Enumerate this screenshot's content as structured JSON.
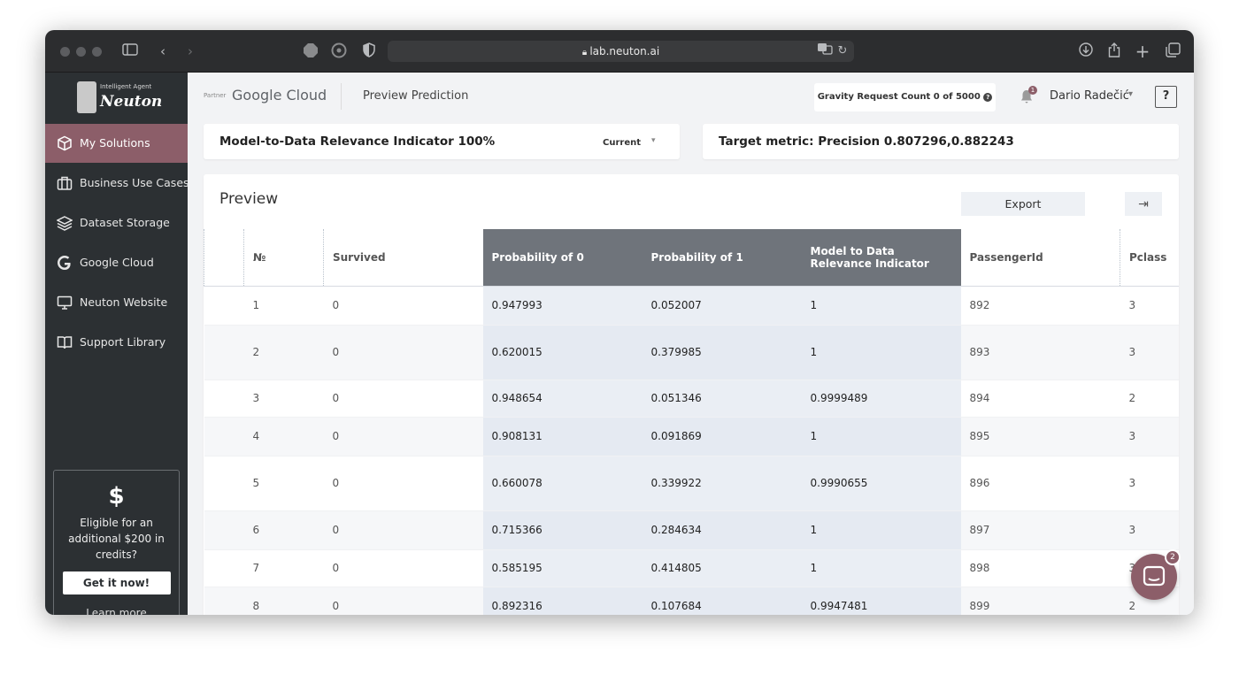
{
  "browser": {
    "url": "lab.neuton.ai"
  },
  "logo": {
    "small": "Intelligent Agent",
    "name": "Neuton"
  },
  "sidebar": {
    "items": [
      {
        "label": "My Solutions",
        "icon": "cube-icon"
      },
      {
        "label": "Business Use Cases",
        "icon": "briefcase-icon"
      },
      {
        "label": "Dataset Storage",
        "icon": "layers-icon"
      },
      {
        "label": "Google Cloud",
        "icon": "google-icon"
      },
      {
        "label": "Neuton Website",
        "icon": "monitor-icon"
      },
      {
        "label": "Support Library",
        "icon": "book-icon"
      }
    ],
    "promo": {
      "symbol": "$",
      "text": "Eligible for an additional $200 in credits?",
      "button": "Get it now!",
      "link": "Learn more"
    }
  },
  "header": {
    "partner": "Partner",
    "cloud": "Google Cloud",
    "crumb": "Preview Prediction",
    "gravity": "Gravity Request Count 0 of 5000",
    "notif_count": "1",
    "user": "Dario Radečić",
    "help": "?"
  },
  "indicator": {
    "label": "Model-to-Data Relevance Indicator 100%",
    "select": "Current"
  },
  "metric": {
    "label": "Target metric: Precision 0.807296,0.882243"
  },
  "preview": {
    "title": "Preview",
    "export": "Export",
    "columns": [
      "№",
      "Survived",
      "Probability of 0",
      "Probability of 1",
      "Model to Data Relevance Indicator",
      "PassengerId",
      "Pclass"
    ],
    "rows": [
      [
        "1",
        "0",
        "0.947993",
        "0.052007",
        "1",
        "892",
        "3"
      ],
      [
        "2",
        "0",
        "0.620015",
        "0.379985",
        "1",
        "893",
        "3"
      ],
      [
        "3",
        "0",
        "0.948654",
        "0.051346",
        "0.9999489",
        "894",
        "2"
      ],
      [
        "4",
        "0",
        "0.908131",
        "0.091869",
        "1",
        "895",
        "3"
      ],
      [
        "5",
        "0",
        "0.660078",
        "0.339922",
        "0.9990655",
        "896",
        "3"
      ],
      [
        "6",
        "0",
        "0.715366",
        "0.284634",
        "1",
        "897",
        "3"
      ],
      [
        "7",
        "0",
        "0.585195",
        "0.414805",
        "1",
        "898",
        "3"
      ],
      [
        "8",
        "0",
        "0.892316",
        "0.107684",
        "0.9947481",
        "899",
        "2"
      ]
    ]
  },
  "chat": {
    "badge": "2"
  }
}
